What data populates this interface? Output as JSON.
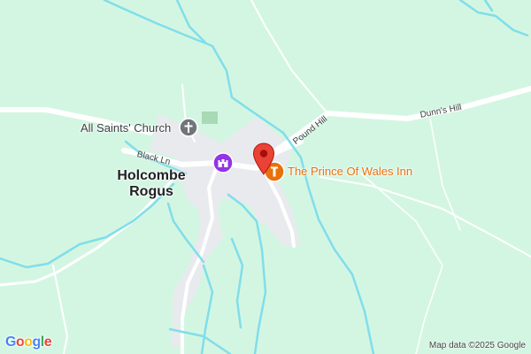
{
  "map": {
    "village_name_line1": "Holcombe",
    "village_name_line2": "Rogus",
    "church_label": "All Saints' Church",
    "inn_label": "The Prince Of Wales Inn",
    "roads": {
      "black_ln": "Black Ln",
      "pound_hill": "Pound Hill",
      "dunns_hill": "Dunn's Hill"
    },
    "icons": {
      "church": "church-icon",
      "landmark": "castle-icon",
      "inn": "restaurant-icon",
      "marker": "location-pin-icon"
    },
    "colors": {
      "land": "#d3f6e2",
      "roads": "#ffffff",
      "water": "#80deea",
      "inn": "#e8710a",
      "marker": "#ea4335",
      "landmark": "#9334e6",
      "church": "#70757a"
    }
  },
  "attribution": {
    "brand_letters": [
      "G",
      "o",
      "o",
      "g",
      "l",
      "e"
    ],
    "map_data": "Map data ©2025 Google"
  }
}
